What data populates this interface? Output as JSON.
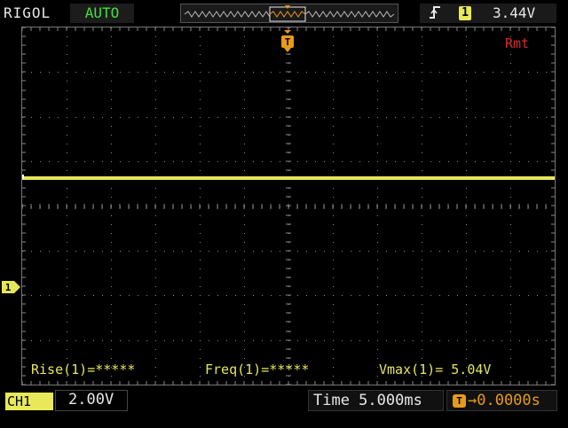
{
  "header": {
    "brand": "RIGOL",
    "mode": "AUTO",
    "trigger_slope_icon": "rising-edge-icon",
    "trigger_source": "1",
    "trigger_level": "3.44V"
  },
  "screen": {
    "remote_label": "Rmt",
    "trigger_marker": "T",
    "channel_marker": "1",
    "trace_color": "#e6e65a"
  },
  "measurements": [
    {
      "label": "Rise(1)=*****"
    },
    {
      "label": "Freq(1)=*****"
    },
    {
      "label": "Vmax(1)= 5.04V"
    }
  ],
  "footer": {
    "channel_label": "CH1",
    "channel_coupling_icon": "dc-coupling-icon",
    "channel_scale": "2.00V",
    "timebase": "Time 5.000ms",
    "trigger_offset_icon": "T",
    "trigger_offset": "→0.0000s"
  }
}
